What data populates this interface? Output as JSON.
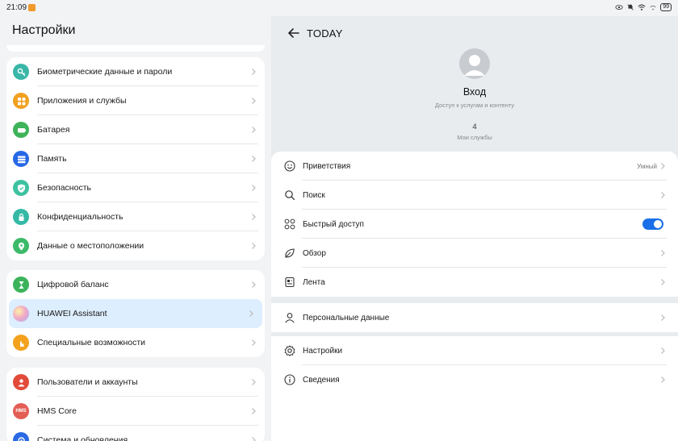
{
  "status": {
    "time": "21:09",
    "battery": "99"
  },
  "left": {
    "title": "Настройки",
    "group1": [
      {
        "label": "Биометрические данные и пароли",
        "icon": "key-icon",
        "color": "#39b6a8"
      },
      {
        "label": "Приложения и службы",
        "icon": "apps-icon",
        "color": "#f0a11f"
      },
      {
        "label": "Батарея",
        "icon": "battery-icon",
        "color": "#3fb35a"
      },
      {
        "label": "Память",
        "icon": "storage-icon",
        "color": "#2668e6"
      },
      {
        "label": "Безопасность",
        "icon": "shield-icon",
        "color": "#3ec2a1"
      },
      {
        "label": "Конфиденциальность",
        "icon": "privacy-icon",
        "color": "#35b9a6"
      },
      {
        "label": "Данные о местоположении",
        "icon": "location-icon",
        "color": "#3bba6a"
      }
    ],
    "group2": [
      {
        "label": "Цифровой баланс",
        "icon": "hourglass-icon",
        "color": "#3bb35a"
      },
      {
        "label": "HUAWEI Assistant",
        "icon": "assistant-icon",
        "color": "#d7a3f3"
      },
      {
        "label": "Специальные возможности",
        "icon": "hand-icon",
        "color": "#f4a21d"
      }
    ],
    "group3": [
      {
        "label": "Пользователи и аккаунты",
        "icon": "user-icon",
        "color": "#e24b3a"
      },
      {
        "label": "HMS Core",
        "icon": "hms-icon",
        "color": "#e35e55",
        "icon_text": "HMS"
      },
      {
        "label": "Система и обновления",
        "icon": "system-icon",
        "color": "#2a6ae4"
      }
    ]
  },
  "right": {
    "title": "TODAY",
    "signin": "Вход",
    "signin_sub": "Доступ к услугам и контенту",
    "services_count": "4",
    "services_label": "Мои службы",
    "group1": [
      {
        "label": "Приветствия",
        "icon": "smile-icon",
        "value": "Умный"
      },
      {
        "label": "Поиск",
        "icon": "search-icon"
      },
      {
        "label": "Быстрый доступ",
        "icon": "grid-icon",
        "toggle": true
      },
      {
        "label": "Обзор",
        "icon": "leaf-icon"
      },
      {
        "label": "Лента",
        "icon": "feed-icon"
      }
    ],
    "group2": [
      {
        "label": "Персональные данные",
        "icon": "person-icon"
      }
    ],
    "group3": [
      {
        "label": "Настройки",
        "icon": "gear-icon"
      },
      {
        "label": "Сведения",
        "icon": "info-icon"
      }
    ]
  }
}
